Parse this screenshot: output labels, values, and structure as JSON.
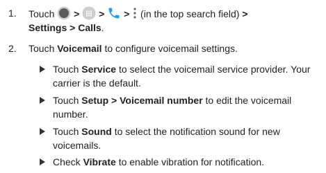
{
  "steps": [
    {
      "number": "1.",
      "line1_touch": "Touch",
      "sep1": ">",
      "sep2": ">",
      "sep3": ">",
      "menu_note": "(in the top search field)",
      "sep4": ">",
      "line2_settings": "Settings",
      "sep5": ">",
      "line2_calls": "Calls",
      "period": "."
    },
    {
      "number": "2.",
      "touch": "Touch",
      "bold": "Voicemail",
      "rest": "to configure voicemail settings."
    }
  ],
  "bullets": [
    {
      "touch": "Touch",
      "bold": "Service",
      "rest": "to select the voicemail service provider. Your carrier is the default."
    },
    {
      "touch": "Touch",
      "bold": "Setup > Voicemail number",
      "rest": "to edit the voicemail number."
    },
    {
      "touch": "Touch",
      "bold": "Sound",
      "rest": "to select the notification sound for new voicemails."
    },
    {
      "touch": "Check",
      "bold": "Vibrate",
      "rest": "to enable vibration for notification."
    }
  ],
  "icons": [
    "home-circle-icon",
    "apps-grid-icon",
    "phone-icon",
    "more-vert-icon"
  ],
  "colors": {
    "text": "#222222",
    "phone": "#1aa3e8",
    "icon_gray": "#666666"
  }
}
